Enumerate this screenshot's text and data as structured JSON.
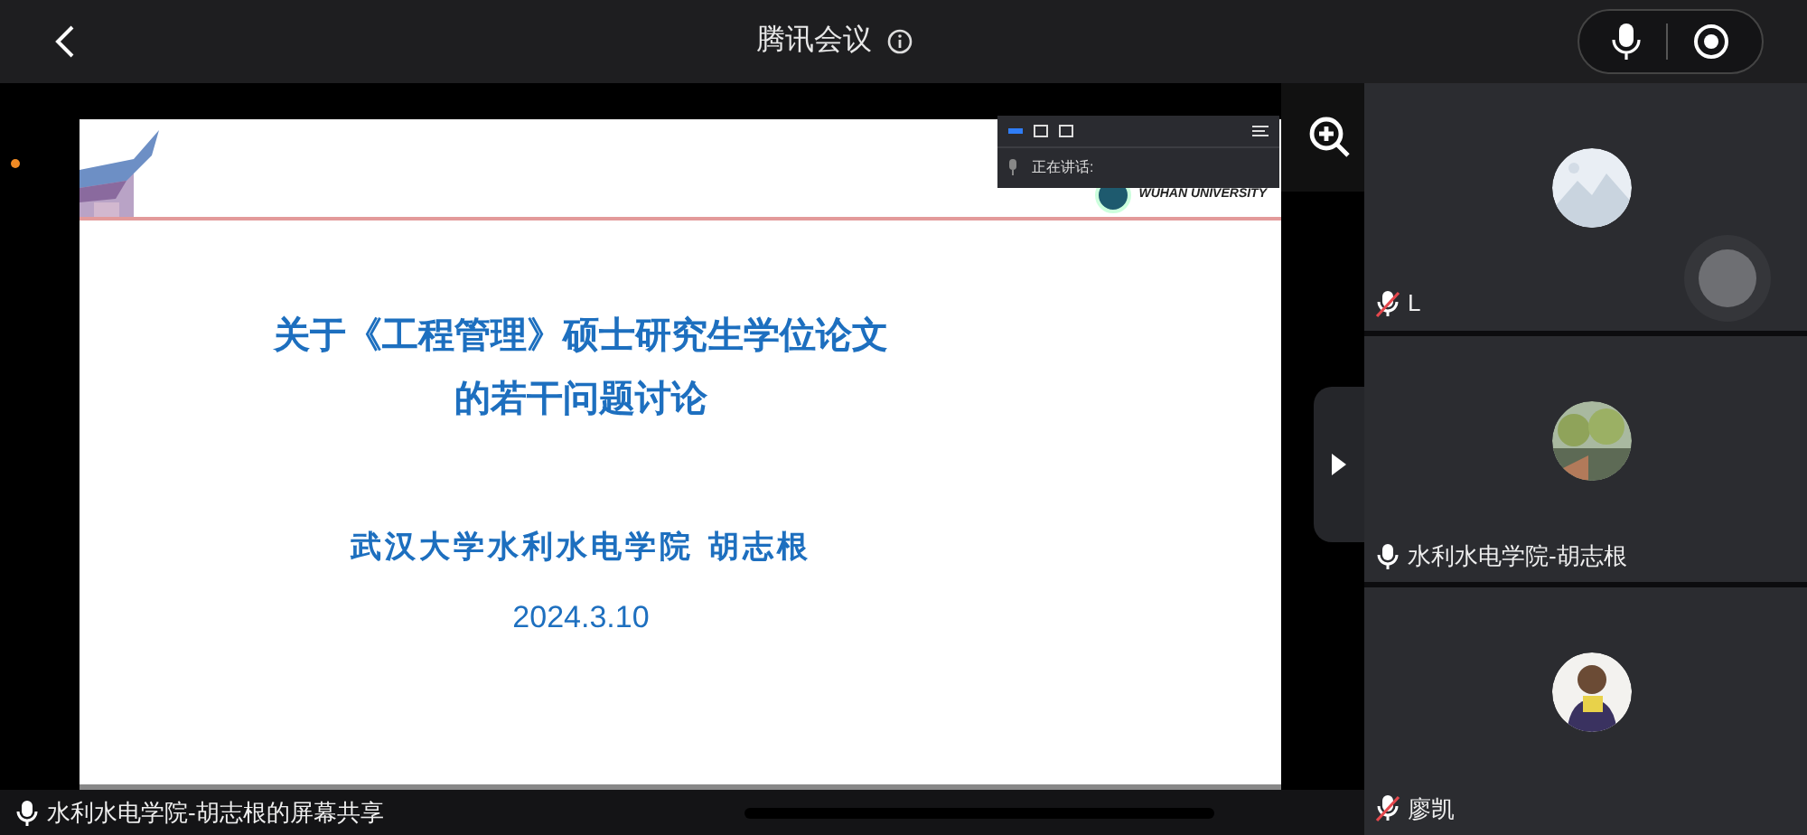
{
  "top_bar": {
    "title": "腾讯会议"
  },
  "slide": {
    "logo_text": "WUHAN UNIVERSITY",
    "title_lines": [
      "关于《工程管理》硕士研究生学位论文",
      "的若干问题讨论"
    ],
    "author": "武汉大学水利水电学院 胡志根",
    "date": "2024.3.10"
  },
  "speaker_panel": {
    "label": "正在讲话:",
    "layouts": [
      {
        "selected": true
      },
      {
        "selected": false
      },
      {
        "selected": false
      }
    ]
  },
  "share_label": {
    "text": "水利水电学院-胡志根的屏幕共享",
    "muted": false
  },
  "participants": [
    {
      "name": "L",
      "muted": true
    },
    {
      "name": "水利水电学院-胡志根",
      "muted": false
    },
    {
      "name": "廖凯",
      "muted": true
    }
  ]
}
